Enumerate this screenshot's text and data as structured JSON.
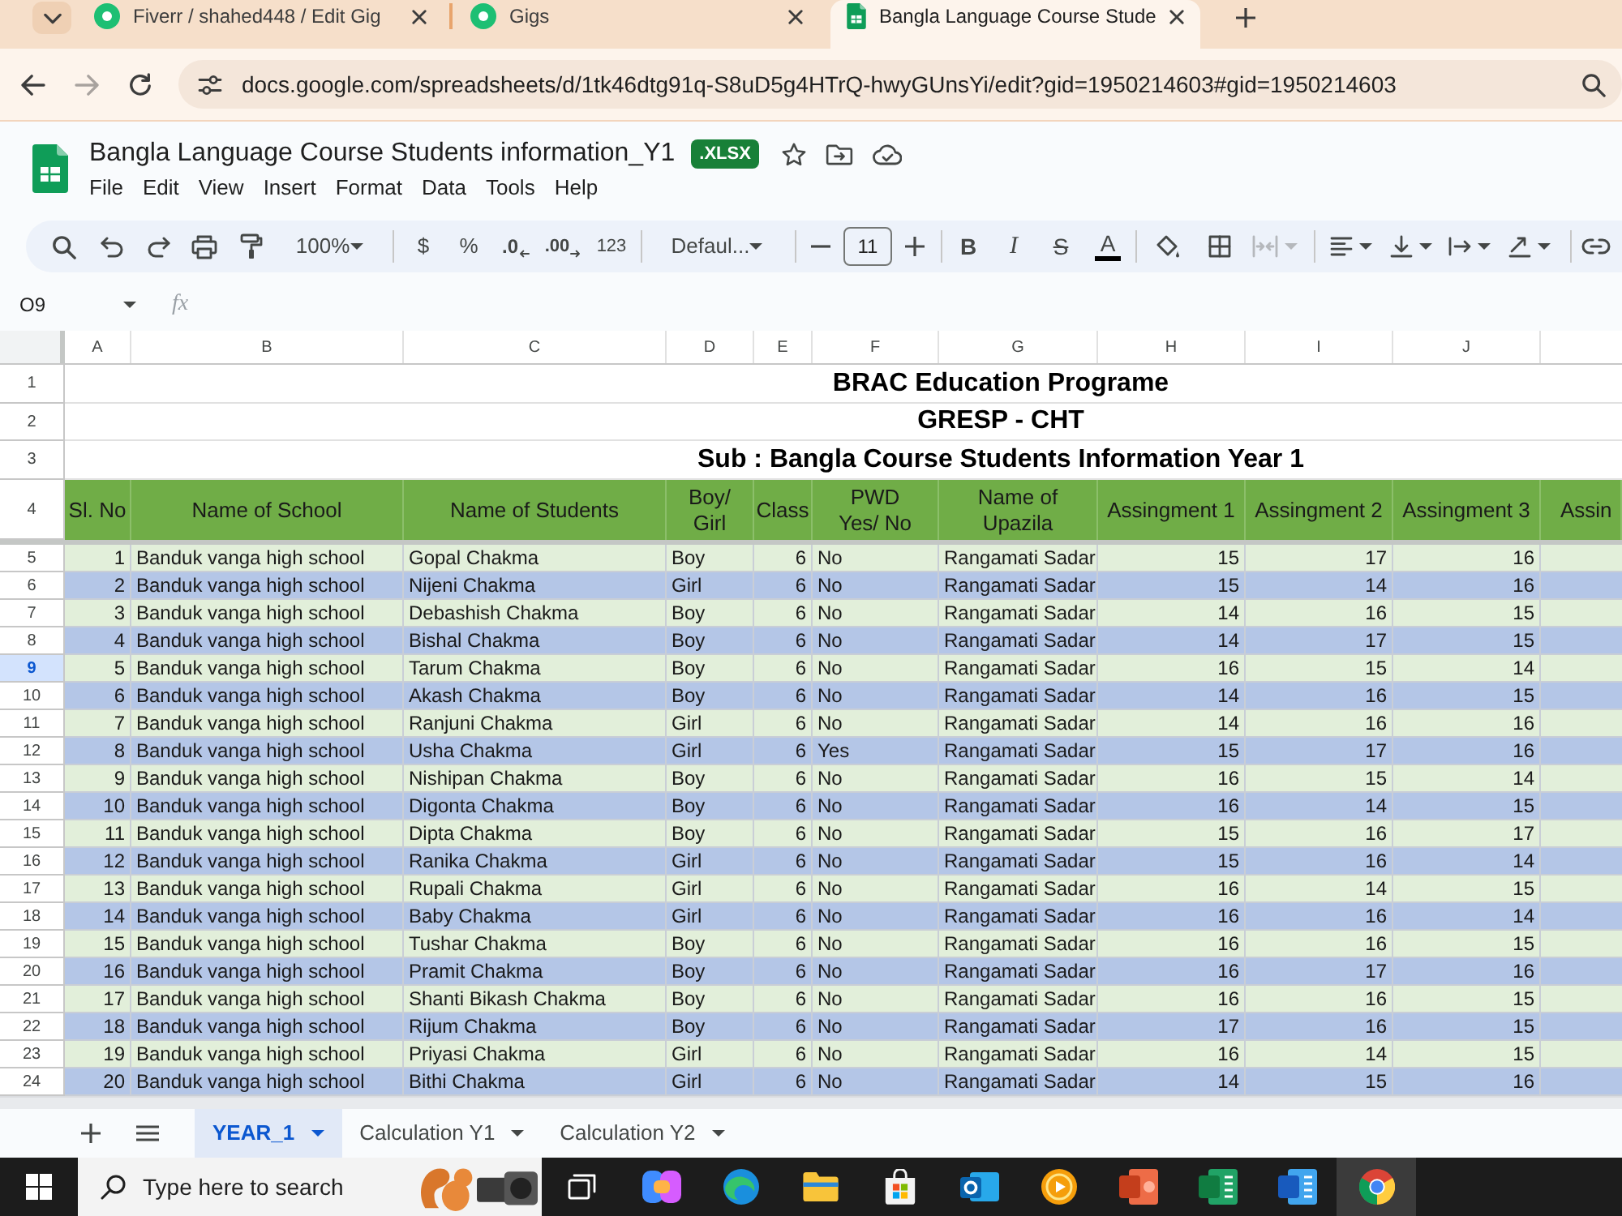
{
  "browser": {
    "tabs": [
      {
        "title": "Fiverr / shahed448 / Edit Gig",
        "selected": false,
        "kind": "circle"
      },
      {
        "title": "Gigs",
        "selected": false,
        "kind": "circle"
      },
      {
        "title": "Bangla Language Course Stude",
        "selected": true,
        "kind": "sheet"
      }
    ],
    "forward_disabled": true,
    "url": "docs.google.com/spreadsheets/d/1tk46dtg91q-S8uD5g4HTrQ-hwyGUnsYi/edit?gid=1950214603#gid=1950214603"
  },
  "document": {
    "title": "Bangla Language Course Students information_Y1",
    "badge": ".XLSX",
    "menus": [
      "File",
      "Edit",
      "View",
      "Insert",
      "Format",
      "Data",
      "Tools",
      "Help"
    ]
  },
  "toolbar": {
    "zoom": "100%",
    "currency": "$",
    "percent": "%",
    "decrease_decimals": ".0",
    "increase_decimals": ".00",
    "number_format": "123",
    "font": "Defaul...",
    "font_size": "11",
    "bold": "B",
    "italic": "I",
    "strikethrough": "S",
    "text_color": "A",
    "merge_disabled": true
  },
  "formula_bar": {
    "cell": "O9",
    "label": "fx"
  },
  "sheet": {
    "columns": [
      "A",
      "B",
      "C",
      "D",
      "E",
      "F",
      "G",
      "H",
      "I",
      "J"
    ],
    "title_rows": [
      {
        "number": "1",
        "text": "BRAC Education Programe"
      },
      {
        "number": "2",
        "text": "GRESP - CHT"
      },
      {
        "number": "3",
        "text": "Sub : Bangla Course Students Information Year 1"
      }
    ],
    "header_row": {
      "number": "4",
      "cells": [
        "Sl. No",
        "Name of School",
        "Name of Students",
        "Boy/\nGirl",
        "Class",
        "PWD\nYes/ No",
        "Name of\nUpazila",
        "Assingment 1",
        "Assingment 2",
        "Assingment 3",
        "Assin"
      ]
    },
    "rows": [
      {
        "number": "5",
        "selected": false,
        "cells": [
          "1",
          "Banduk vanga high school",
          "Gopal Chakma",
          "Boy",
          "6",
          "No",
          "Rangamati Sadar",
          "15",
          "17",
          "16"
        ]
      },
      {
        "number": "6",
        "selected": false,
        "cells": [
          "2",
          "Banduk vanga high school",
          "Nijeni Chakma",
          "Girl",
          "6",
          "No",
          "Rangamati Sadar",
          "15",
          "14",
          "16"
        ]
      },
      {
        "number": "7",
        "selected": false,
        "cells": [
          "3",
          "Banduk vanga high school",
          "Debashish Chakma",
          "Boy",
          "6",
          "No",
          "Rangamati Sadar",
          "14",
          "16",
          "15"
        ]
      },
      {
        "number": "8",
        "selected": false,
        "cells": [
          "4",
          "Banduk vanga high school",
          "Bishal Chakma",
          "Boy",
          "6",
          "No",
          "Rangamati Sadar",
          "14",
          "17",
          "15"
        ]
      },
      {
        "number": "9",
        "selected": true,
        "cells": [
          "5",
          "Banduk vanga high school",
          "Tarum Chakma",
          "Boy",
          "6",
          "No",
          "Rangamati Sadar",
          "16",
          "15",
          "14"
        ]
      },
      {
        "number": "10",
        "selected": false,
        "cells": [
          "6",
          "Banduk vanga high school",
          "Akash Chakma",
          "Boy",
          "6",
          "No",
          "Rangamati Sadar",
          "14",
          "16",
          "15"
        ]
      },
      {
        "number": "11",
        "selected": false,
        "cells": [
          "7",
          "Banduk vanga high school",
          "Ranjuni Chakma",
          "Girl",
          "6",
          "No",
          "Rangamati Sadar",
          "14",
          "16",
          "16"
        ]
      },
      {
        "number": "12",
        "selected": false,
        "cells": [
          "8",
          "Banduk vanga high school",
          "Usha Chakma",
          "Girl",
          "6",
          "Yes",
          "Rangamati Sadar",
          "15",
          "17",
          "16"
        ]
      },
      {
        "number": "13",
        "selected": false,
        "cells": [
          "9",
          "Banduk vanga high school",
          "Nishipan Chakma",
          "Boy",
          "6",
          "No",
          "Rangamati Sadar",
          "16",
          "15",
          "14"
        ]
      },
      {
        "number": "14",
        "selected": false,
        "cells": [
          "10",
          "Banduk vanga high school",
          "Digonta Chakma",
          "Boy",
          "6",
          "No",
          "Rangamati Sadar",
          "16",
          "14",
          "15"
        ]
      },
      {
        "number": "15",
        "selected": false,
        "cells": [
          "11",
          "Banduk vanga high school",
          "Dipta Chakma",
          "Boy",
          "6",
          "No",
          "Rangamati Sadar",
          "15",
          "16",
          "17"
        ]
      },
      {
        "number": "16",
        "selected": false,
        "cells": [
          "12",
          "Banduk vanga high school",
          "Ranika Chakma",
          "Girl",
          "6",
          "No",
          "Rangamati Sadar",
          "15",
          "16",
          "14"
        ]
      },
      {
        "number": "17",
        "selected": false,
        "cells": [
          "13",
          "Banduk vanga high school",
          "Rupali Chakma",
          "Girl",
          "6",
          "No",
          "Rangamati Sadar",
          "16",
          "14",
          "15"
        ]
      },
      {
        "number": "18",
        "selected": false,
        "cells": [
          "14",
          "Banduk vanga high school",
          "Baby Chakma",
          "Girl",
          "6",
          "No",
          "Rangamati Sadar",
          "16",
          "16",
          "14"
        ]
      },
      {
        "number": "19",
        "selected": false,
        "cells": [
          "15",
          "Banduk vanga high school",
          "Tushar Chakma",
          "Boy",
          "6",
          "No",
          "Rangamati Sadar",
          "16",
          "16",
          "15"
        ]
      },
      {
        "number": "20",
        "selected": false,
        "cells": [
          "16",
          "Banduk vanga high school",
          "Pramit Chakma",
          "Boy",
          "6",
          "No",
          "Rangamati Sadar",
          "16",
          "17",
          "16"
        ]
      },
      {
        "number": "21",
        "selected": false,
        "cells": [
          "17",
          "Banduk vanga high school",
          "Shanti Bikash Chakma",
          "Boy",
          "6",
          "No",
          "Rangamati Sadar",
          "16",
          "16",
          "15"
        ]
      },
      {
        "number": "22",
        "selected": false,
        "cells": [
          "18",
          "Banduk vanga high school",
          "Rijum Chakma",
          "Boy",
          "6",
          "No",
          "Rangamati Sadar",
          "17",
          "16",
          "15"
        ]
      },
      {
        "number": "23",
        "selected": false,
        "cells": [
          "19",
          "Banduk vanga high school",
          "Priyasi Chakma",
          "Girl",
          "6",
          "No",
          "Rangamati Sadar",
          "16",
          "14",
          "15"
        ]
      },
      {
        "number": "24",
        "selected": false,
        "cells": [
          "20",
          "Banduk vanga high school",
          "Bithi Chakma",
          "Girl",
          "6",
          "No",
          "Rangamati Sadar",
          "14",
          "15",
          "16"
        ]
      }
    ]
  },
  "sheet_tabs": [
    {
      "label": "YEAR_1",
      "selected": true
    },
    {
      "label": "Calculation Y1",
      "selected": false
    },
    {
      "label": "Calculation Y2",
      "selected": false
    }
  ],
  "taskbar": {
    "search": {
      "placeholder": "Type here to search"
    },
    "apps": [
      {
        "kind": "task-view",
        "active": false
      },
      {
        "kind": "copilot",
        "active": false
      },
      {
        "kind": "edge",
        "active": false
      },
      {
        "kind": "explorer",
        "active": false
      },
      {
        "kind": "store",
        "active": false
      },
      {
        "kind": "outlook",
        "active": false
      },
      {
        "kind": "media",
        "active": false
      },
      {
        "kind": "powerpoint",
        "active": false
      },
      {
        "kind": "excel",
        "active": false
      },
      {
        "kind": "word",
        "active": false
      },
      {
        "kind": "chrome",
        "active": true
      }
    ]
  }
}
